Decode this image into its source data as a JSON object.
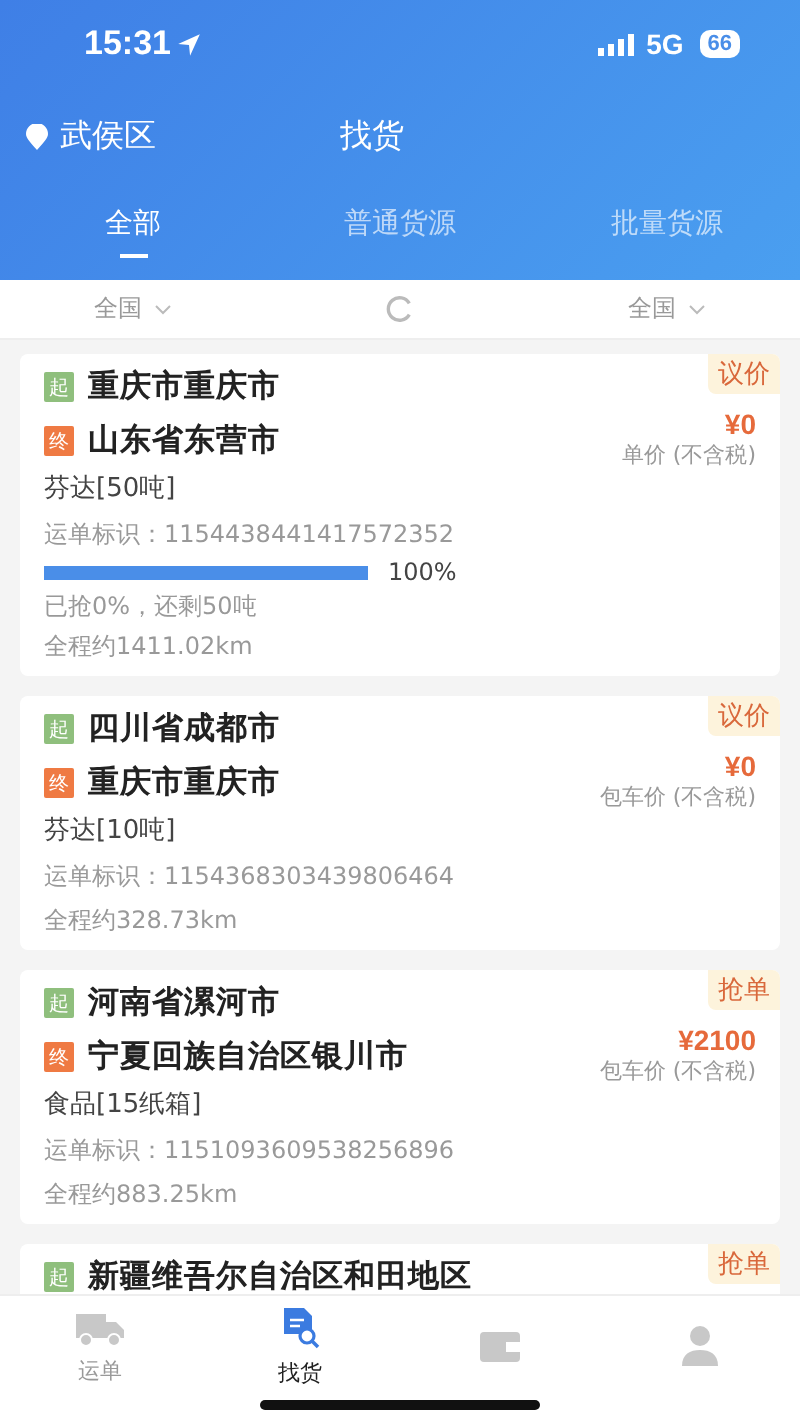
{
  "status_bar": {
    "time": "15:31",
    "network": "5G",
    "battery": "66"
  },
  "header": {
    "location": "武侯区",
    "title": "找货"
  },
  "tabs": [
    {
      "label": "全部",
      "selected": true
    },
    {
      "label": "普通货源",
      "selected": false
    },
    {
      "label": "批量货源",
      "selected": false
    }
  ],
  "filters": {
    "origin": "全国",
    "destination": "全国"
  },
  "cards": [
    {
      "tag": "议价",
      "route": [
        {
          "kind": "start",
          "badge": "起",
          "place": "重庆市重庆市"
        },
        {
          "kind": "end",
          "badge": "终",
          "place": "山东省东营市"
        }
      ],
      "price": "¥0",
      "price_note": "单价 (不含税)",
      "goods": "芬达[50吨]",
      "waybill": "运单标识：1154438441417572352",
      "progress": {
        "level": 1.0,
        "reading": "100%",
        "note": "已抢0%，还剩50吨"
      },
      "distance": "全程约1411.02km"
    },
    {
      "tag": "议价",
      "route": [
        {
          "kind": "start",
          "badge": "起",
          "place": "四川省成都市"
        },
        {
          "kind": "end",
          "badge": "终",
          "place": "重庆市重庆市"
        }
      ],
      "price": "¥0",
      "price_note": "包车价 (不含税)",
      "goods": "芬达[10吨]",
      "waybill": "运单标识：1154368303439806464",
      "distance": "全程约328.73km"
    },
    {
      "tag": "抢单",
      "route": [
        {
          "kind": "start",
          "badge": "起",
          "place": "河南省漯河市"
        },
        {
          "kind": "end",
          "badge": "终",
          "place": "宁夏回族自治区银川市"
        }
      ],
      "price": "¥2100",
      "price_note": "包车价 (不含税)",
      "goods": "食品[15纸箱]",
      "waybill": "运单标识：1151093609538256896",
      "distance": "全程约883.25km"
    },
    {
      "tag": "抢单",
      "route": [
        {
          "kind": "start",
          "badge": "起",
          "place": "新疆维吾尔自治区和田地区"
        }
      ]
    }
  ],
  "nav": [
    {
      "kind": "truck",
      "label": "运单",
      "selected": false
    },
    {
      "kind": "search-doc",
      "label": "找货",
      "selected": true
    },
    {
      "kind": "wallet",
      "selected": false
    },
    {
      "kind": "person",
      "selected": false
    }
  ]
}
